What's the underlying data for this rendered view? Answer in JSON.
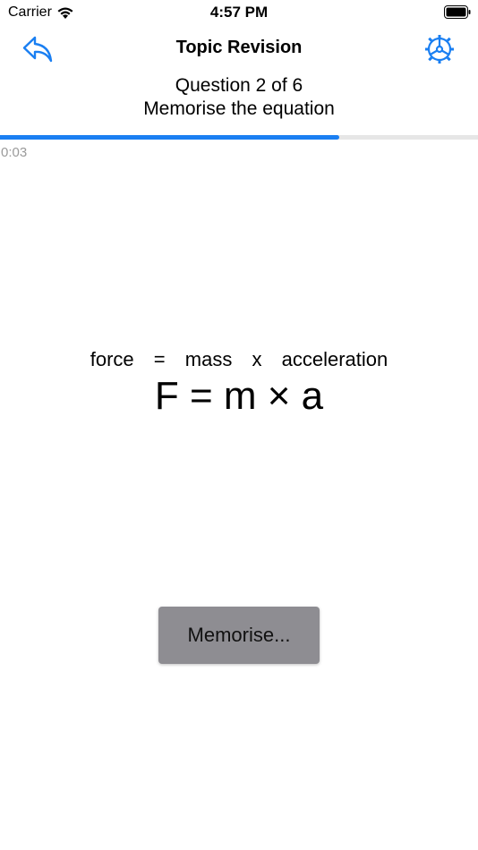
{
  "status_bar": {
    "carrier": "Carrier",
    "time": "4:57 PM"
  },
  "nav": {
    "title": "Topic Revision",
    "back_icon": "reply-arrow-icon",
    "settings_icon": "gear-icon"
  },
  "question": {
    "counter": "Question 2 of 6",
    "instruction": "Memorise the equation",
    "progress": 0.71,
    "timer": "0:03"
  },
  "equation": {
    "words": [
      "force",
      "=",
      "mass",
      "x",
      "acceleration"
    ],
    "formula": "F = m × a"
  },
  "memorise_button": {
    "label": "Memorise..."
  },
  "colors": {
    "accent": "#1a7ff2",
    "button_bg": "#8e8d92",
    "timer_text": "#9a9a9a"
  }
}
